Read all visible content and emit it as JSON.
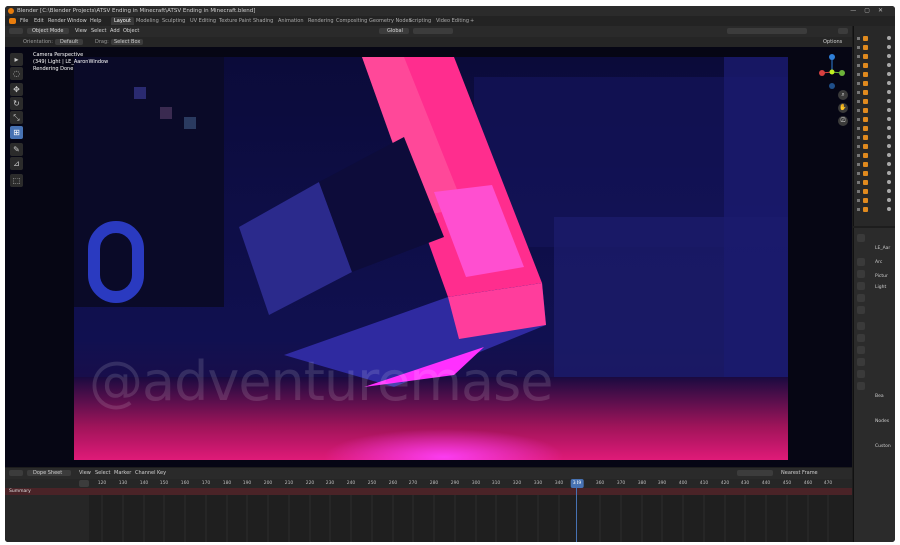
{
  "window": {
    "title": "Blender [C:\\Blender Projects\\ATSV Ending in Minecraft\\ATSV Ending in Minecraft.blend]",
    "controls": [
      "—",
      "▢",
      "✕"
    ]
  },
  "menu": {
    "items": [
      "File",
      "Edit",
      "Render",
      "Window",
      "Help"
    ],
    "workspaces": [
      "Layout",
      "Modeling",
      "Sculpting",
      "UV Editing",
      "Texture Paint",
      "Shading",
      "Animation",
      "Rendering",
      "Compositing",
      "Geometry Nodes",
      "Scripting",
      "Video Editing",
      "+"
    ],
    "active_workspace": "Layout"
  },
  "viewport_header": {
    "mode": "Object Mode",
    "menus": [
      "View",
      "Select",
      "Add",
      "Object"
    ],
    "transform": "Global",
    "orientation_label": "Orientation:",
    "orientation_value": "Default",
    "drag_label": "Drag:",
    "drag_value": "Select Box",
    "options": "Options"
  },
  "viewport_overlay": {
    "line1": "Camera Perspective",
    "line2": "(349) Light | LE_AaronWindow",
    "line3": "Rendering Done"
  },
  "watermark": "@adventuremase",
  "toolbar_icons": [
    "cursor-icon",
    "select-circle-icon",
    "move-icon",
    "rotate-icon",
    "scale-icon",
    "transform-icon",
    "annotate-icon",
    "measure-icon",
    "add-cube-icon"
  ],
  "timeline": {
    "editor": "Dope Sheet",
    "menus": [
      "View",
      "Select",
      "Marker",
      "Channel",
      "Key"
    ],
    "snap": "Nearest Frame",
    "ticks": [
      "120",
      "130",
      "140",
      "150",
      "160",
      "170",
      "180",
      "190",
      "200",
      "210",
      "220",
      "230",
      "240",
      "250",
      "260",
      "270",
      "280",
      "290",
      "300",
      "310",
      "320",
      "330",
      "340",
      "349",
      "360",
      "370",
      "380",
      "390",
      "400",
      "410",
      "420",
      "430",
      "440",
      "450",
      "460",
      "470"
    ],
    "current_frame": "349",
    "summary_label": "Summary"
  },
  "properties": {
    "labels": [
      "LE_Aar",
      "Arc",
      "Pictur",
      "Light",
      "Bea",
      "Nodes",
      "Custon"
    ]
  },
  "colors": {
    "accent": "#4772b3",
    "blender_orange": "#e87d0d",
    "render_pink": "#ff2d8e",
    "render_blue": "#2b2a8c"
  }
}
